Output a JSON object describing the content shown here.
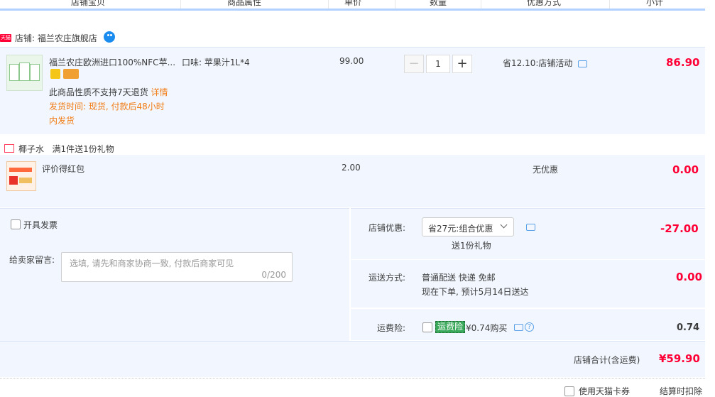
{
  "header": {
    "col_item": "店铺宝贝",
    "col_props": "商品属性",
    "col_price": "单价",
    "col_qty": "数量",
    "col_discount": "优惠方式",
    "col_subtotal": "小计"
  },
  "shop": {
    "badge": "天猫",
    "name": "店铺: 福兰农庄旗舰店"
  },
  "item1": {
    "title": "福兰农庄欧洲进口100%NFC苹...",
    "props": "口味: 苹果汁1L*4",
    "price": "99.00",
    "quantity": "1",
    "discount": "省12.10:店铺活动",
    "subtotal": "86.90",
    "no_return": "此商品性质不支持7天退货",
    "details_link": "详情",
    "ship_line1": "发货时间: 现货, 付款后48小时",
    "ship_line2": "内发货"
  },
  "gift_promo": {
    "name": "椰子水",
    "rule": "满1件送1份礼物"
  },
  "item2": {
    "title": "评价得红包",
    "price": "2.00",
    "discount": "无优惠",
    "subtotal": "0.00"
  },
  "order_options": {
    "invoice_label": "开具发票",
    "message_label": "给卖家留言:",
    "message_placeholder": "选填, 请先和商家协商一致, 付款后商家可见",
    "message_counter": "0/200"
  },
  "shop_discount": {
    "label": "店铺优惠:",
    "selected": "省27元:组合优惠",
    "gift_note": "送1份礼物",
    "amount": "-27.00"
  },
  "delivery": {
    "label": "运送方式:",
    "method": "普通配送 快递 免邮",
    "eta": "现在下单, 预计5月14日送达",
    "amount": "0.00"
  },
  "insurance": {
    "label": "运费险:",
    "badge": "运费险",
    "price": "¥0.74购买",
    "amount": "0.74"
  },
  "total": {
    "label": "店铺合计(含运费)",
    "amount": "¥59.90"
  },
  "footer": {
    "coupon_label": "使用天猫卡券",
    "deduct_label": "结算时扣除"
  }
}
